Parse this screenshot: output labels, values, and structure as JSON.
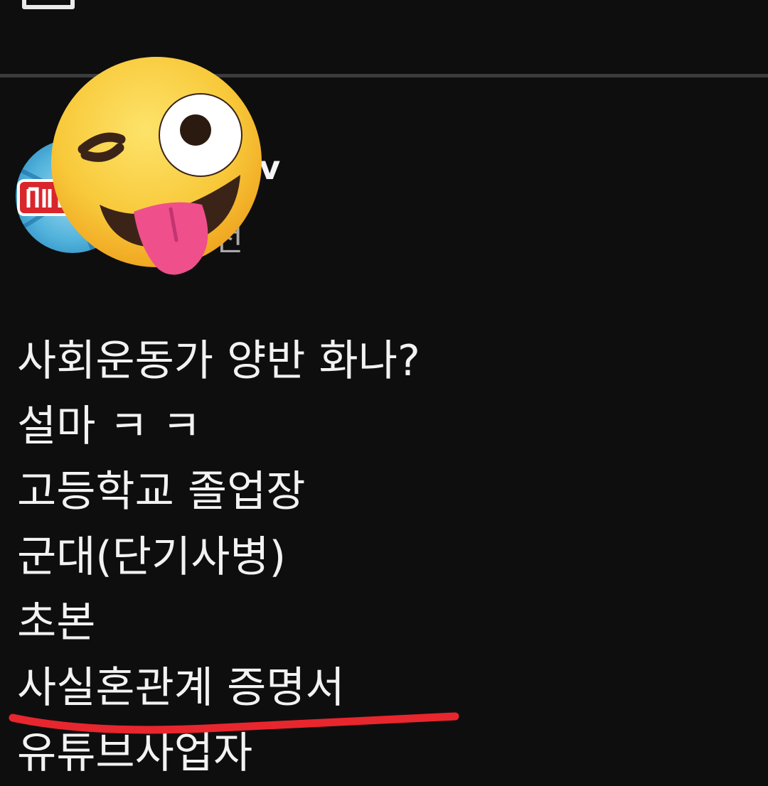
{
  "post": {
    "channel_name_visible": "방tv",
    "time_visible": "전"
  },
  "comment_lines": [
    "사회운동가 양반 화나?",
    "설마 ㅋ ㅋ",
    "고등학교 졸업장",
    "군대(단기사병)",
    "초본",
    "사실혼관계 증명서",
    "유튜브사업자"
  ],
  "icons": {
    "overlay": "winking-face-with-tongue-icon",
    "top_left": "bookmark-tray-icon"
  },
  "colors": {
    "background": "#0f0e0f",
    "divider": "#3c3c3e",
    "text": "#f2f2f2",
    "muted_text": "#a9a9a9",
    "annotation_red": "#e8262e",
    "emoji_yellow": "#f8c93a"
  }
}
